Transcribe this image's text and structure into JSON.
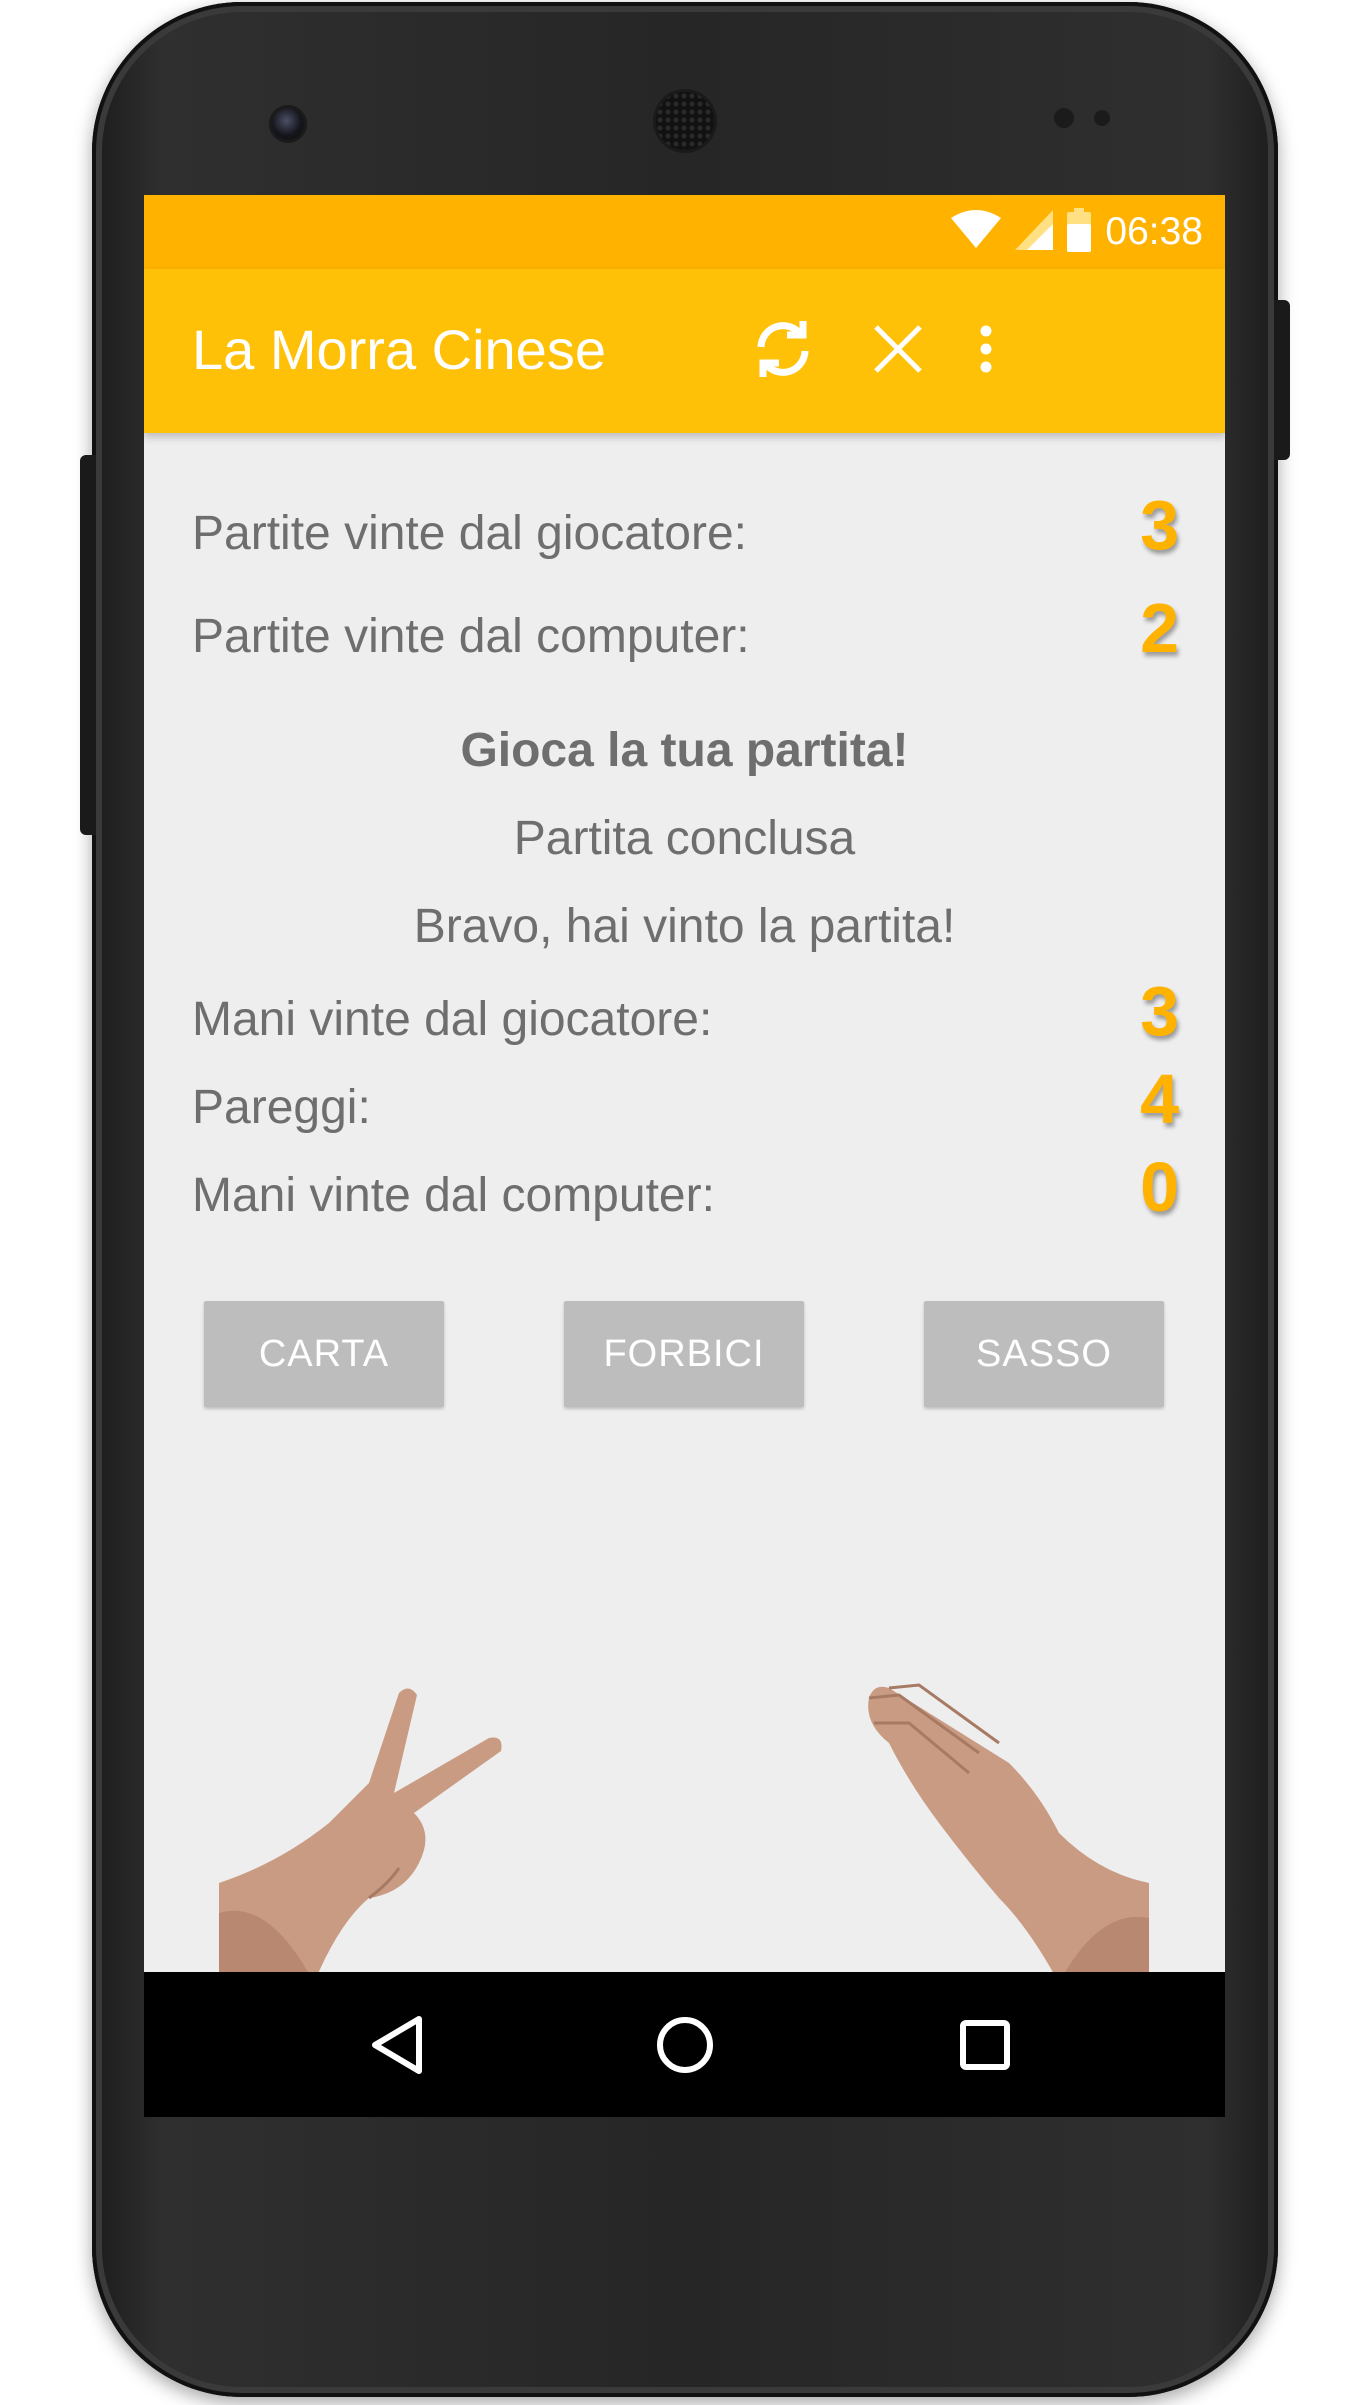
{
  "status_bar": {
    "time": "06:38",
    "icons": [
      "wifi-icon",
      "signal-icon",
      "battery-icon"
    ],
    "color": "#ffb300"
  },
  "app_bar": {
    "title": "La Morra Cinese",
    "actions": [
      "refresh-icon",
      "close-icon",
      "more-vert-icon"
    ],
    "color": "#ffc107"
  },
  "score": {
    "player_games_label": "Partite vinte dal giocatore:",
    "player_games_value": "3",
    "computer_games_label": "Partite vinte dal computer:",
    "computer_games_value": "2"
  },
  "game": {
    "heading": "Gioca la tua partita!",
    "status": "Partita conclusa",
    "result": "Bravo, hai vinto la partita!"
  },
  "hands": {
    "player_hands_label": "Mani vinte dal giocatore:",
    "player_hands_value": "3",
    "draws_label": "Pareggi:",
    "draws_value": "4",
    "computer_hands_label": "Mani vinte dal computer:",
    "computer_hands_value": "0"
  },
  "buttons": {
    "carta": "CARTA",
    "forbici": "FORBICI",
    "sasso": "SASSO"
  },
  "images": {
    "player_choice": "scissors-hand",
    "computer_choice": "paper-hand"
  },
  "nav_bar": {
    "icons": [
      "back-icon",
      "home-icon",
      "recents-icon"
    ]
  },
  "colors": {
    "accent": "#ffb300",
    "value_text": "#ffb300",
    "button_bg": "#bdbdbd"
  }
}
